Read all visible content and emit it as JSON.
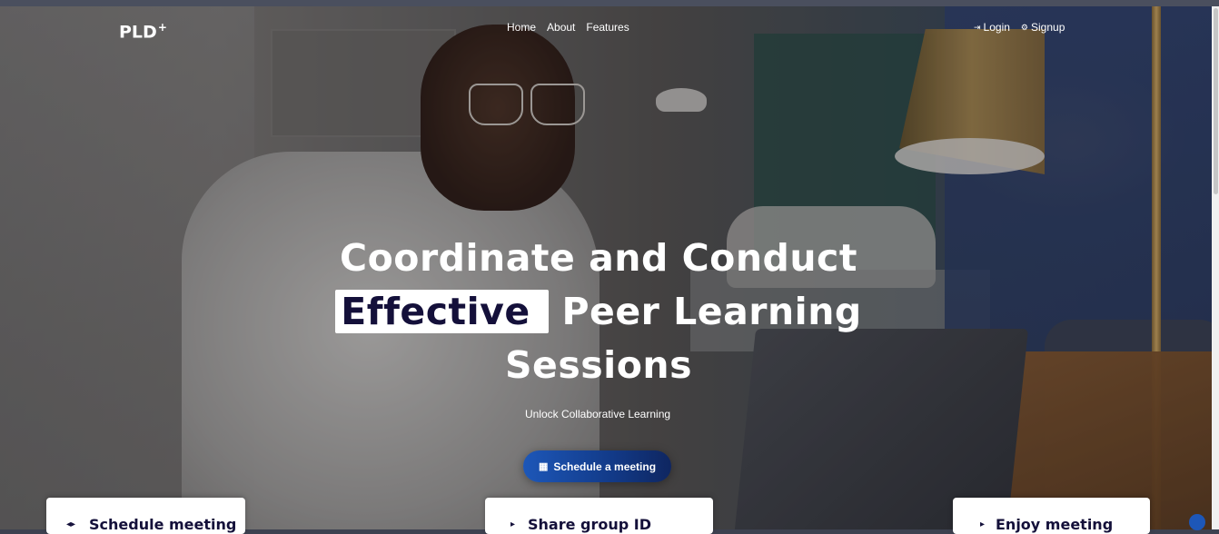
{
  "brand": {
    "name": "PLD",
    "mark": "+"
  },
  "nav": {
    "items": [
      "Home",
      "About",
      "Features"
    ]
  },
  "auth": {
    "login": {
      "icon": "login-icon",
      "label": "Login"
    },
    "signup": {
      "icon": "user-plus-icon",
      "label": "Signup"
    }
  },
  "hero": {
    "line1": "Coordinate and Conduct",
    "highlight": "Effective",
    "line2_rest": "Peer Learning",
    "line3": "Sessions",
    "subtitle": "Unlock Collaborative Learning",
    "cta": {
      "icon": "calendar-icon",
      "label": "Schedule a meeting"
    }
  },
  "cards": [
    {
      "title": "Schedule meeting"
    },
    {
      "title": "Share group ID"
    },
    {
      "title": "Enjoy meeting"
    }
  ],
  "colors": {
    "accent": "#1d57b8",
    "dark_text": "#14103a"
  }
}
